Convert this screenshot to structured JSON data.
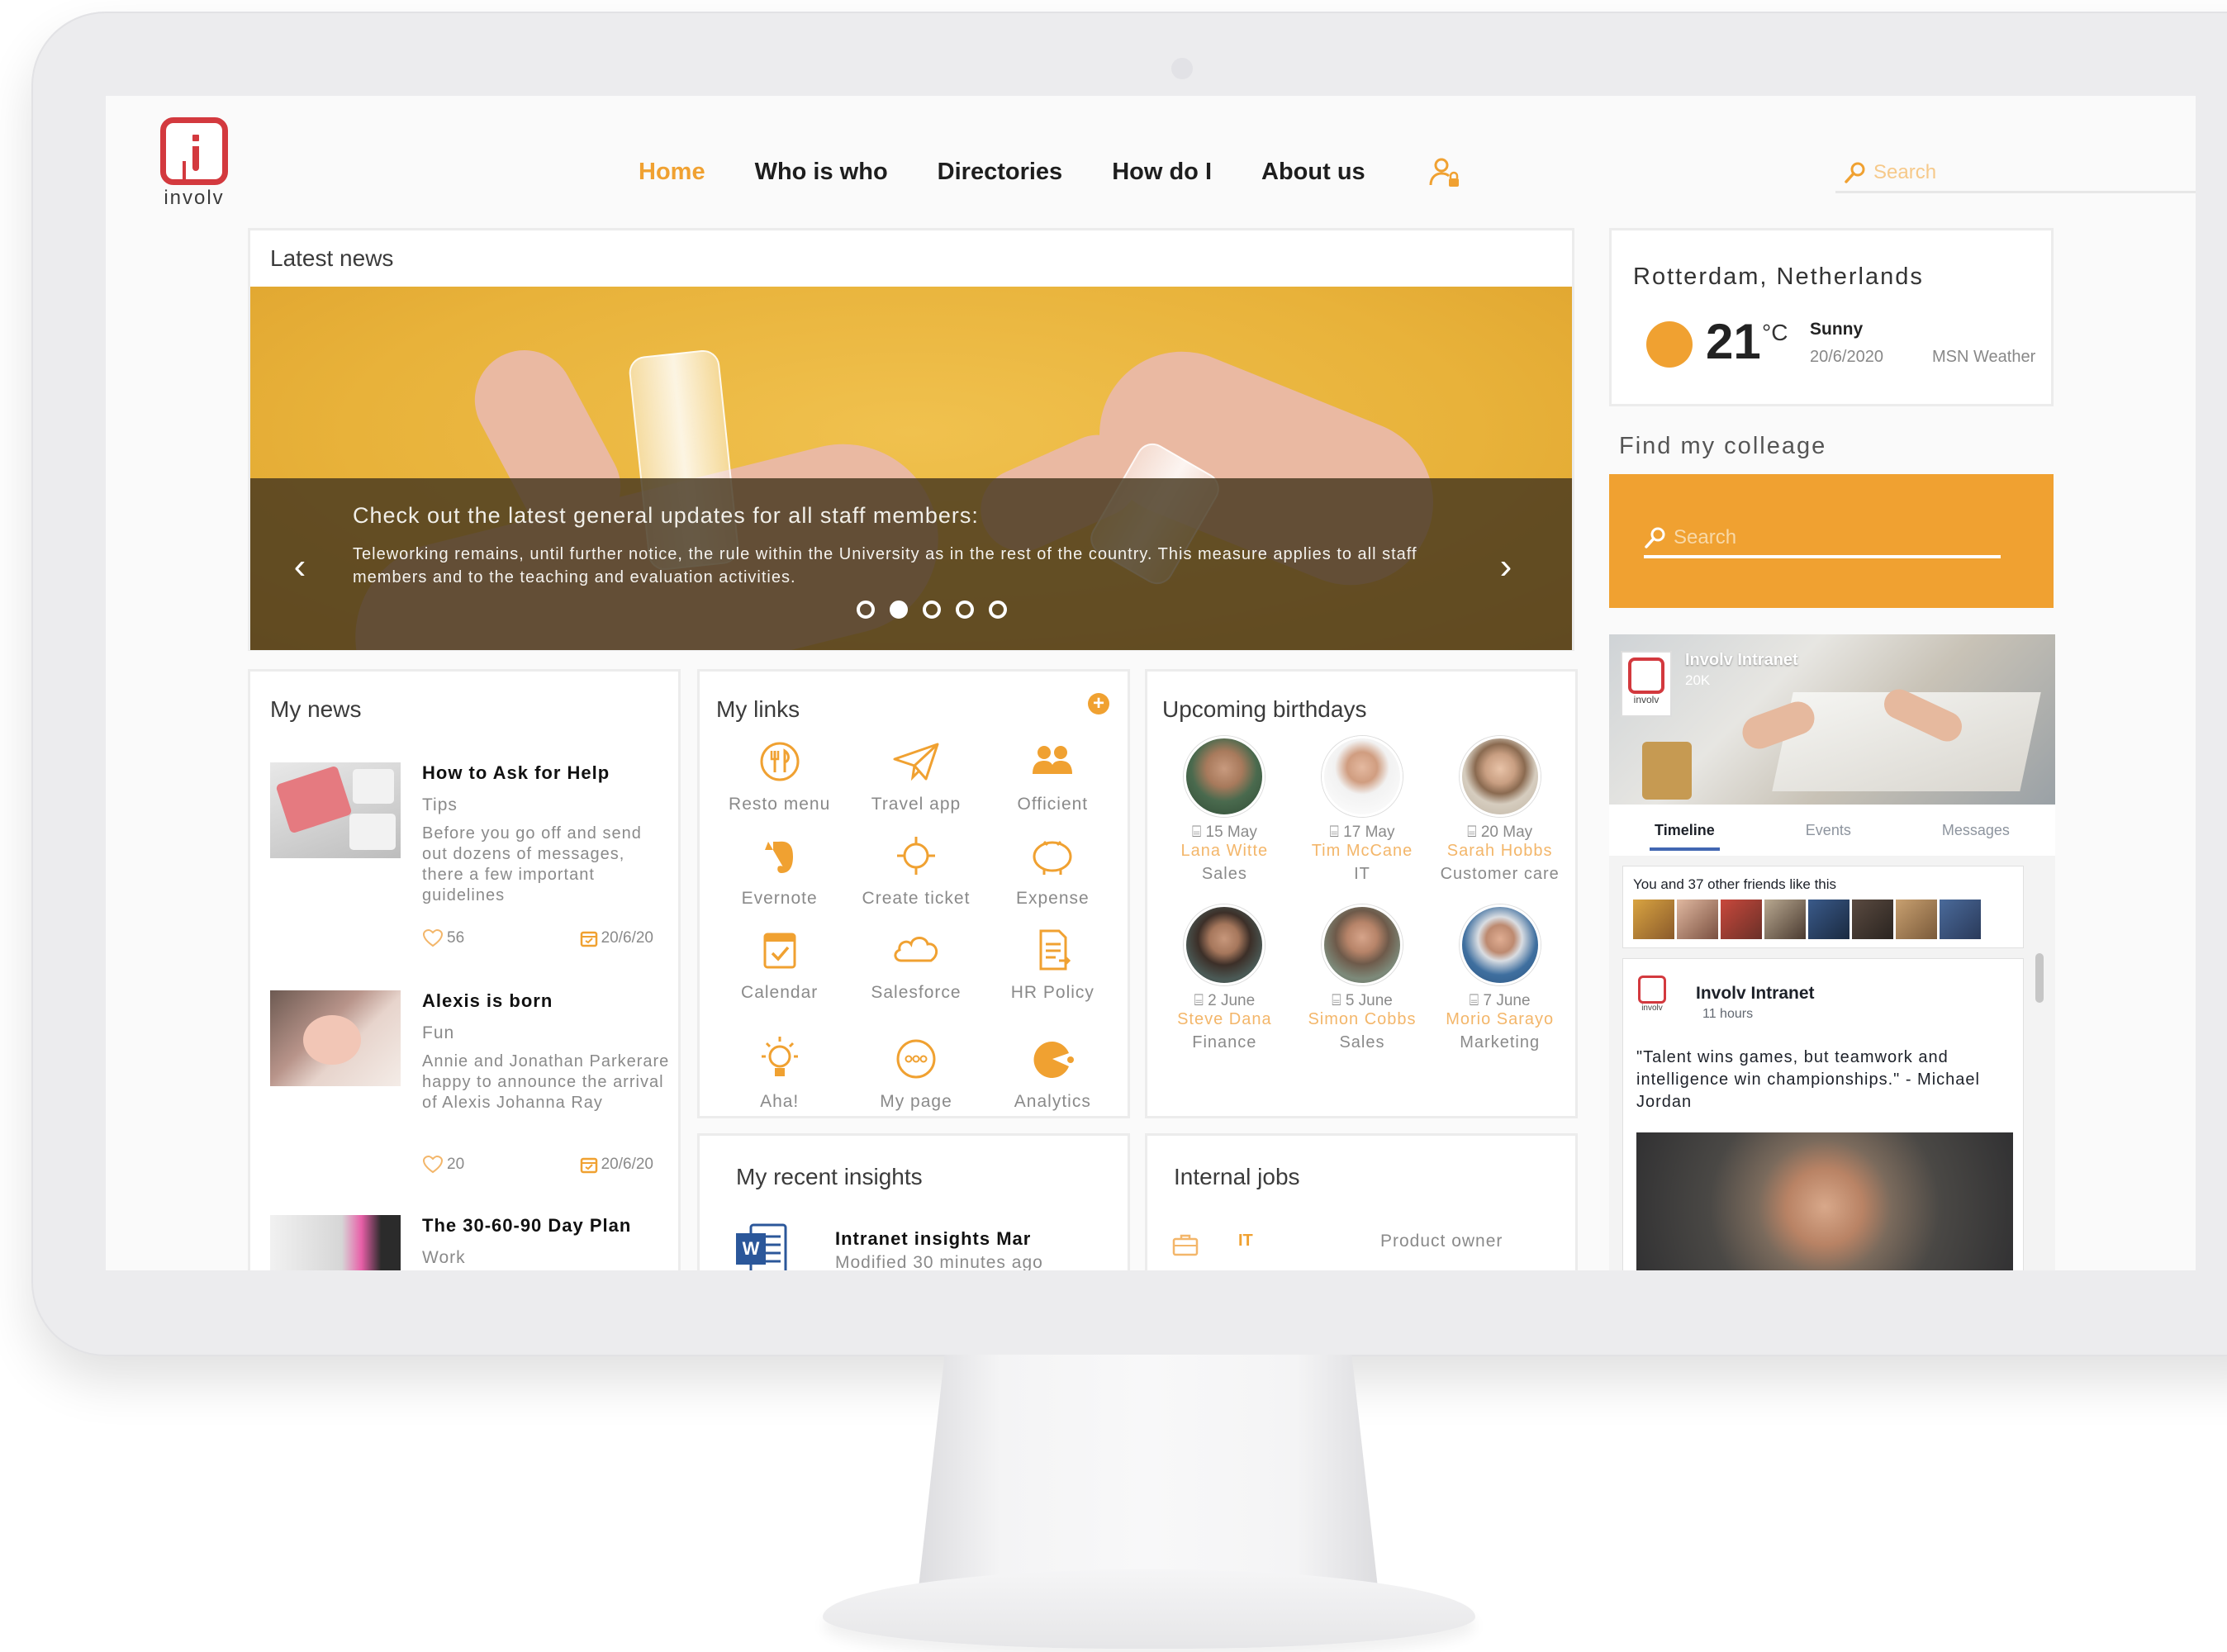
{
  "logo": {
    "text": "involv"
  },
  "nav": {
    "items": [
      {
        "label": "Home",
        "active": true
      },
      {
        "label": "Who is who",
        "active": false
      },
      {
        "label": "Directories",
        "active": false
      },
      {
        "label": "How do I",
        "active": false
      },
      {
        "label": "About us",
        "active": false
      }
    ],
    "user_icon": "user-lock-icon"
  },
  "search": {
    "placeholder": "Search"
  },
  "latest_news": {
    "title": "Latest news",
    "headline": "Check out the latest general updates for all staff members:",
    "body": "Teleworking remains, until further notice, the rule within the University as in the rest of the country. This measure applies to all staff members and to the teaching and evaluation activities.",
    "slide_count": 5,
    "active_slide": 2
  },
  "my_news": {
    "title": "My news",
    "items": [
      {
        "title": "How to Ask for Help",
        "category": "Tips",
        "text": "Before you go off and send out dozens of messages, there a few important guidelines",
        "likes": "56",
        "date": "20/6/20"
      },
      {
        "title": "Alexis is born",
        "category": "Fun",
        "text": "Annie and Jonathan Parkerare happy to announce the arrival of Alexis Johanna Ray",
        "likes": "20",
        "date": "20/6/20"
      },
      {
        "title": "The 30-60-90 Day Plan",
        "category": "Work",
        "text": "",
        "likes": "",
        "date": ""
      }
    ]
  },
  "my_links": {
    "title": "My links",
    "add_icon": "plus-circle-icon",
    "items": [
      {
        "label": "Resto menu",
        "icon": "restaurant-icon"
      },
      {
        "label": "Travel app",
        "icon": "paper-plane-icon"
      },
      {
        "label": "Officient",
        "icon": "people-icon"
      },
      {
        "label": "Evernote",
        "icon": "evernote-icon"
      },
      {
        "label": "Create ticket",
        "icon": "ticket-icon"
      },
      {
        "label": "Expense",
        "icon": "piggy-bank-icon"
      },
      {
        "label": "Calendar",
        "icon": "calendar-icon"
      },
      {
        "label": "Salesforce",
        "icon": "cloud-icon"
      },
      {
        "label": "HR Policy",
        "icon": "document-icon"
      },
      {
        "label": "Aha!",
        "icon": "lightbulb-icon"
      },
      {
        "label": "My page",
        "icon": "dots-circle-icon"
      },
      {
        "label": "Analytics",
        "icon": "pie-chart-icon"
      }
    ]
  },
  "birthdays": {
    "title": "Upcoming birthdays",
    "items": [
      {
        "date": "15 May",
        "name": "Lana Witte",
        "dept": "Sales",
        "color": "#4a6a4e"
      },
      {
        "date": "17 May",
        "name": "Tim McCane",
        "dept": "IT",
        "color": "#e9e9e9"
      },
      {
        "date": "20 May",
        "name": "Sarah Hobbs",
        "dept": "Customer care",
        "color": "#d6cdbf"
      },
      {
        "date": "2 June",
        "name": "Steve Dana",
        "dept": "Finance",
        "color": "#4b5a56"
      },
      {
        "date": "5 June",
        "name": "Simon Cobbs",
        "dept": "Sales",
        "color": "#7d8a7a"
      },
      {
        "date": "7 June",
        "name": "Morio Sarayo",
        "dept": "Marketing",
        "color": "#3f6f9f"
      }
    ]
  },
  "insights": {
    "title": "My recent insights",
    "item_title": "Intranet insights Mar",
    "item_sub": "Modified 30 minutes ago"
  },
  "jobs": {
    "title": "Internal jobs",
    "dept": "IT",
    "job": "Product owner"
  },
  "weather": {
    "city": "Rotterdam, Netherlands",
    "temp": "21",
    "unit": "°C",
    "condition": "Sunny",
    "date": "20/6/2020",
    "source": "MSN Weather"
  },
  "find_colleague": {
    "title": "Find my colleage",
    "placeholder": "Search"
  },
  "facebook": {
    "page_name": "Involv Intranet",
    "followers": "20K",
    "tabs": [
      {
        "label": "Timeline",
        "active": true
      },
      {
        "label": "Events",
        "active": false
      },
      {
        "label": "Messages",
        "active": false
      }
    ],
    "likes_text": "You and 37 other friends like this",
    "post_author": "Involv Intranet",
    "post_time": "11 hours",
    "post_text": "\"Talent wins games, but teamwork and intelligence win championships.\" - Michael Jordan"
  },
  "colors": {
    "accent": "#f0a131",
    "brand_red": "#d3393e"
  }
}
